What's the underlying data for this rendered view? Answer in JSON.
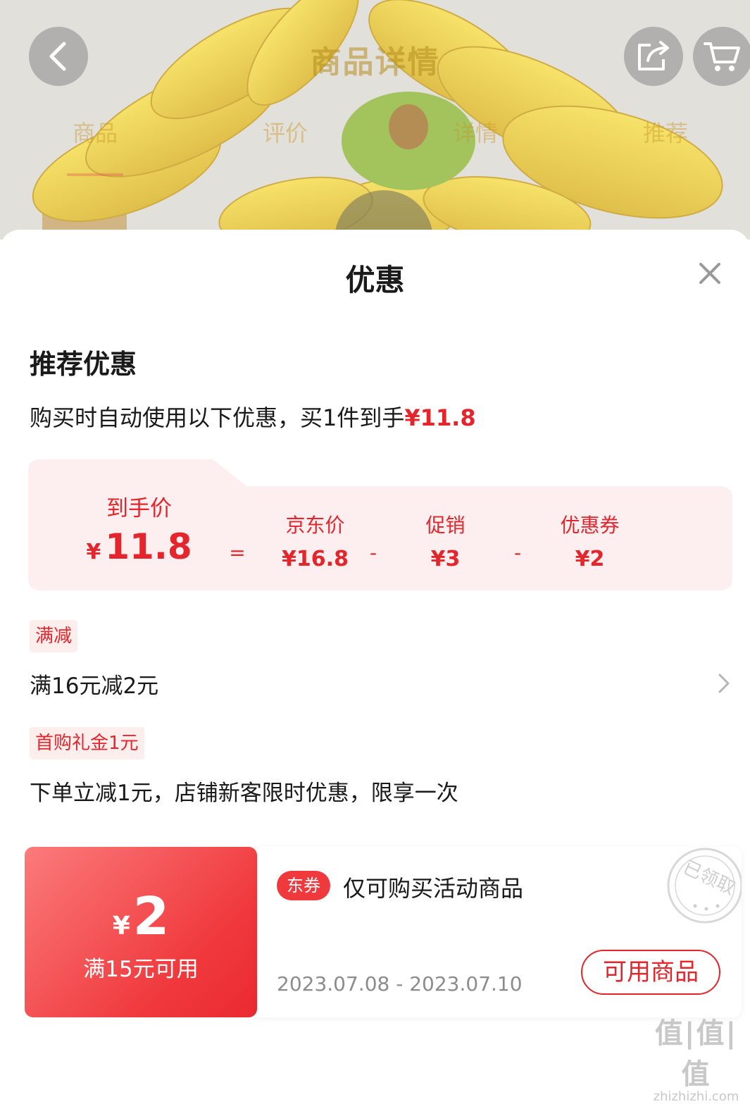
{
  "header": {
    "title": "商品详情",
    "tabs": [
      "商品",
      "评价",
      "详情",
      "推荐"
    ],
    "active_tab": 0
  },
  "icons": {
    "back": "back-arrow-icon",
    "share": "share-icon",
    "cart": "cart-icon",
    "close": "close-icon",
    "chevron": "chevron-right-icon"
  },
  "colors": {
    "accent": "#e4262c",
    "tag_bg": "#fdeeee",
    "card_bg": "#fdeef0"
  },
  "sheet": {
    "title": "优惠",
    "section_title": "推荐优惠",
    "summary_prefix": "购买时自动使用以下优惠，买1件到手",
    "summary_price": "¥11.8"
  },
  "price_breakdown": {
    "final_label": "到手价",
    "final_currency": "¥",
    "final_value": "11.8",
    "equals": "=",
    "minus": "-",
    "items": [
      {
        "label": "京东价",
        "value": "¥16.8"
      },
      {
        "label": "促销",
        "value": "¥3"
      },
      {
        "label": "优惠券",
        "value": "¥2"
      }
    ]
  },
  "promotions": [
    {
      "tag": "满减",
      "text": "满16元减2元"
    },
    {
      "tag": "首购礼金1元",
      "text": "下单立减1元，店铺新客限时优惠，限享一次"
    }
  ],
  "coupon": {
    "currency": "¥",
    "amount": "2",
    "condition": "满15元可用",
    "badge": "东券",
    "description": "仅可购买活动商品",
    "validity": "2023.07.08 - 2023.07.10",
    "button": "可用商品",
    "stamp": "已领取"
  },
  "watermark": {
    "mark": "值|值|值",
    "url": "zhizhizhi.com"
  }
}
